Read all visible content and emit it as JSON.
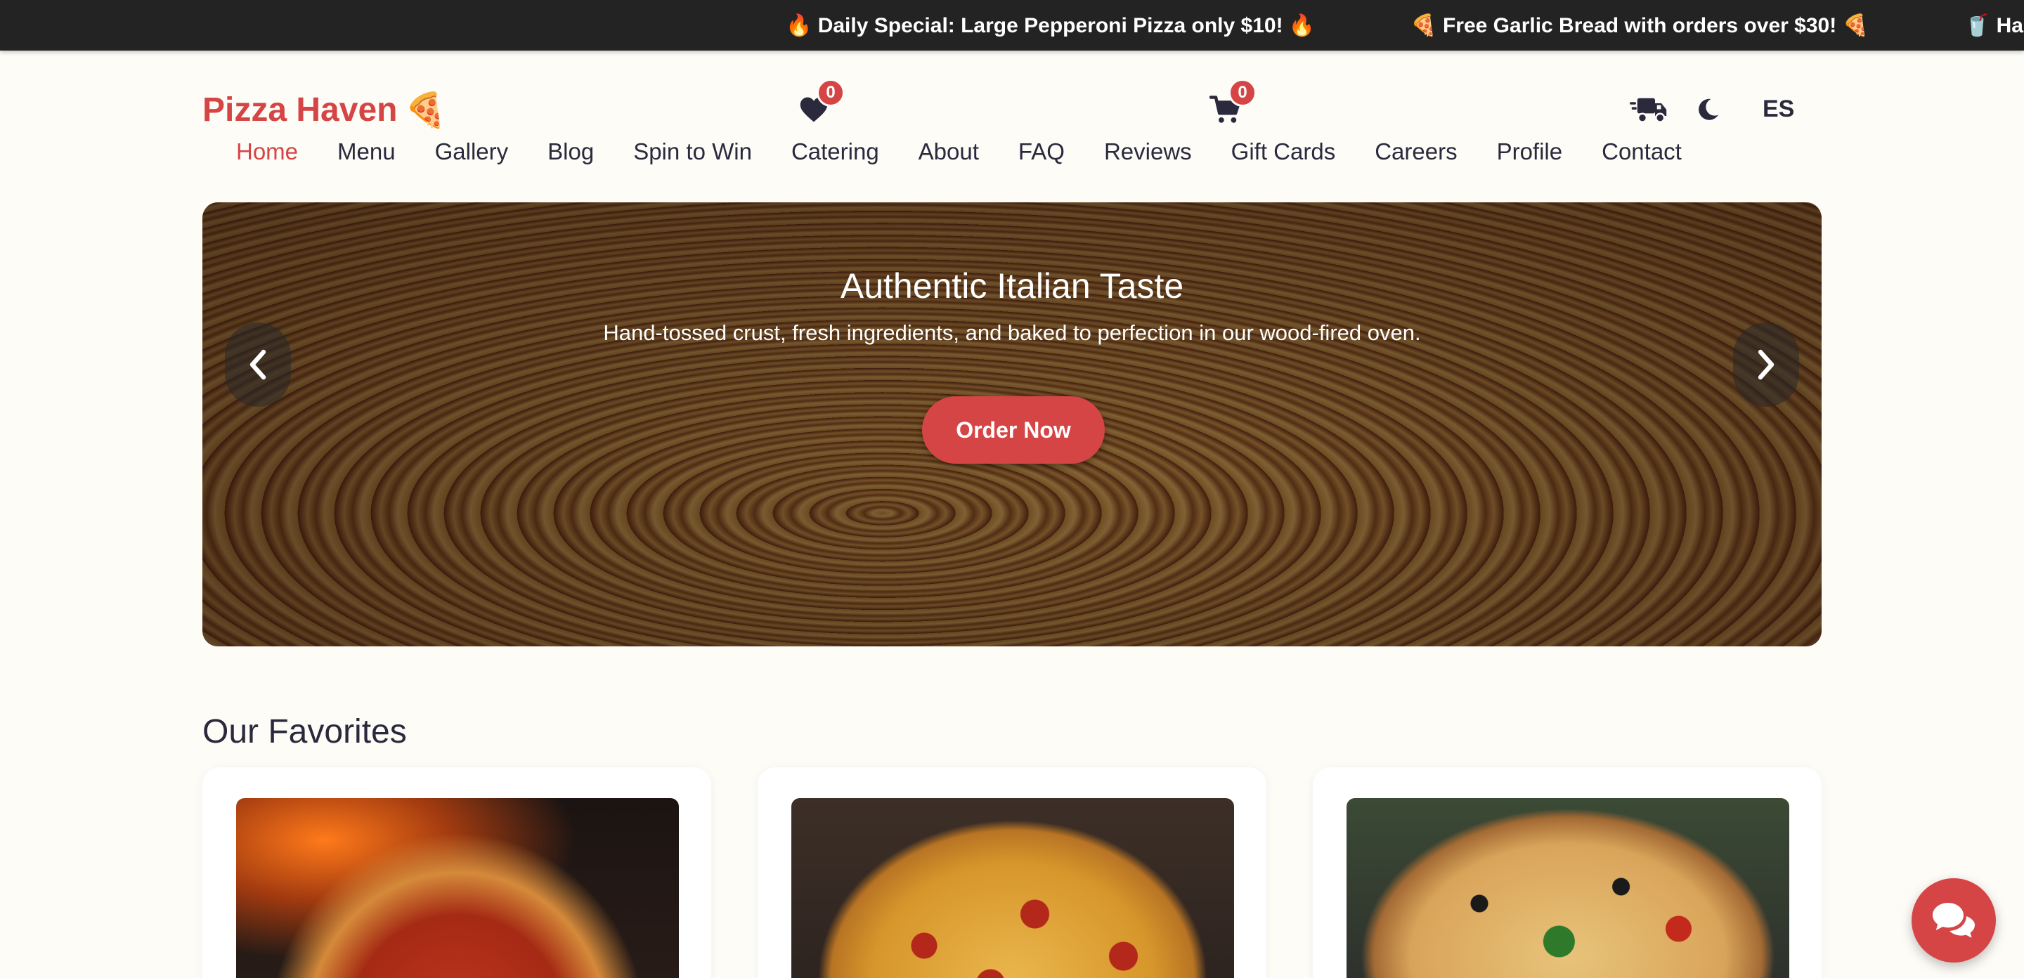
{
  "ticker": {
    "items": [
      "🔥 Daily Special: Large Pepperoni Pizza only $10! 🔥",
      "🍕 Free Garlic Bread with orders over $30! 🍕",
      "🥤 Hap"
    ]
  },
  "header": {
    "logo_text": "Pizza Haven",
    "logo_emoji": "🍕",
    "wishlist_count": "0",
    "cart_count": "0",
    "language": "ES",
    "icons": [
      "heart-icon",
      "cart-icon",
      "delivery-truck-icon",
      "moon-icon"
    ]
  },
  "nav": {
    "items": [
      {
        "label": "Home",
        "active": true
      },
      {
        "label": "Menu"
      },
      {
        "label": "Gallery"
      },
      {
        "label": "Blog"
      },
      {
        "label": "Spin to Win"
      },
      {
        "label": "Catering"
      },
      {
        "label": "About"
      },
      {
        "label": "FAQ"
      },
      {
        "label": "Reviews"
      },
      {
        "label": "Gift Cards"
      },
      {
        "label": "Careers"
      },
      {
        "label": "Profile"
      },
      {
        "label": "Contact"
      }
    ]
  },
  "hero": {
    "title": "Authentic Italian Taste",
    "subtitle": "Hand-tossed crust, fresh ingredients, and baked to perfection in our wood-fired oven.",
    "button_label": "Order Now"
  },
  "favorites": {
    "title": "Our Favorites"
  },
  "colors": {
    "accent": "#d64545",
    "text": "#2b2a3d",
    "background": "#fdfcf7",
    "ticker_bg": "#232323"
  }
}
